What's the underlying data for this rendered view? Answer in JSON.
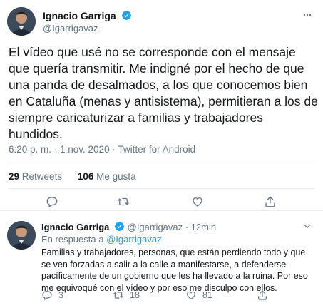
{
  "main_tweet": {
    "name": "Ignacio Garriga",
    "handle": "@Igarrigavaz",
    "text": "El vídeo que usé no se corresponde con el mensaje que quería transmitir. Me indigné por el hecho de que una panda de desalmados, a los que conocemos bien en Cataluña (menas y antisistema), permitieran a los de siempre caricaturizar a familias y trabajadores hundidos.",
    "meta": "6:20 p. m. · 1 nov. 2020 · Twitter for Android",
    "retweets_count": "29",
    "retweets_label": "Retweets",
    "likes_count": "106",
    "likes_label": "Me gusta"
  },
  "reply_tweet": {
    "name": "Ignacio Garriga",
    "handle_time": "@Igarrigavaz · 12min",
    "in_reply_prefix": "En respuesta a",
    "in_reply_handle": "@Igarrigavaz",
    "text": "Familias y trabajadores, personas, que están perdiendo todo y que se ven forzadas a salir a la calle a manifestarse, a defenderse pacíficamente de un gobierno que les ha llevado a la ruina. Por eso me equivoqué con el vídeo y por eso me disculpo con ellos.",
    "reply_count": "3",
    "retweet_count": "18",
    "like_count": "81"
  },
  "colors": {
    "verified": "#1da1f2",
    "link": "#1da1f2",
    "muted": "#657786",
    "divider": "#e6ecf0"
  },
  "icons": [
    "verified-badge-icon",
    "more-chevron-icon",
    "reply-icon",
    "retweet-icon",
    "like-icon",
    "share-icon"
  ]
}
